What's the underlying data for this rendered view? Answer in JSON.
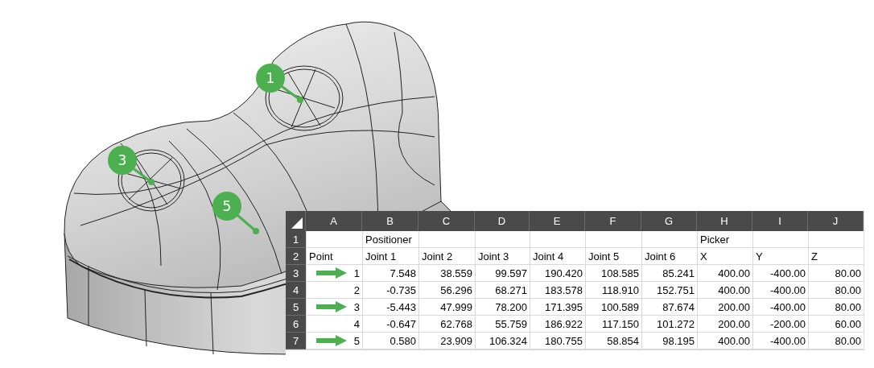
{
  "callouts": [
    {
      "label": "1"
    },
    {
      "label": "3"
    },
    {
      "label": "5"
    }
  ],
  "spreadsheet": {
    "column_headers": [
      "A",
      "B",
      "C",
      "D",
      "E",
      "F",
      "G",
      "H",
      "I",
      "J"
    ],
    "group_row": {
      "row_header": "1",
      "positioner": "Positioner",
      "picker": "Picker"
    },
    "label_row": {
      "row_header": "2",
      "labels": [
        "Point",
        "Joint 1",
        "Joint 2",
        "Joint 3",
        "Joint 4",
        "Joint 5",
        "Joint 6",
        "X",
        "Y",
        "Z"
      ]
    },
    "rows": [
      {
        "row_header": "3",
        "arrow": true,
        "point": "1",
        "values": [
          "7.548",
          "38.559",
          "99.597",
          "190.420",
          "108.585",
          "85.241",
          "400.00",
          "-400.00",
          "80.00"
        ]
      },
      {
        "row_header": "4",
        "arrow": false,
        "point": "2",
        "values": [
          "-0.735",
          "56.296",
          "68.271",
          "183.578",
          "118.910",
          "152.751",
          "400.00",
          "-400.00",
          "80.00"
        ]
      },
      {
        "row_header": "5",
        "arrow": true,
        "point": "3",
        "values": [
          "-5.443",
          "47.999",
          "78.200",
          "171.395",
          "100.589",
          "87.674",
          "200.00",
          "-400.00",
          "80.00"
        ]
      },
      {
        "row_header": "6",
        "arrow": false,
        "point": "4",
        "values": [
          "-0.647",
          "62.768",
          "55.759",
          "186.922",
          "117.150",
          "101.272",
          "200.00",
          "-200.00",
          "60.00"
        ]
      },
      {
        "row_header": "7",
        "arrow": true,
        "point": "5",
        "values": [
          "0.580",
          "23.909",
          "106.324",
          "180.755",
          "58.854",
          "98.195",
          "400.00",
          "-400.00",
          "80.00"
        ]
      }
    ]
  }
}
